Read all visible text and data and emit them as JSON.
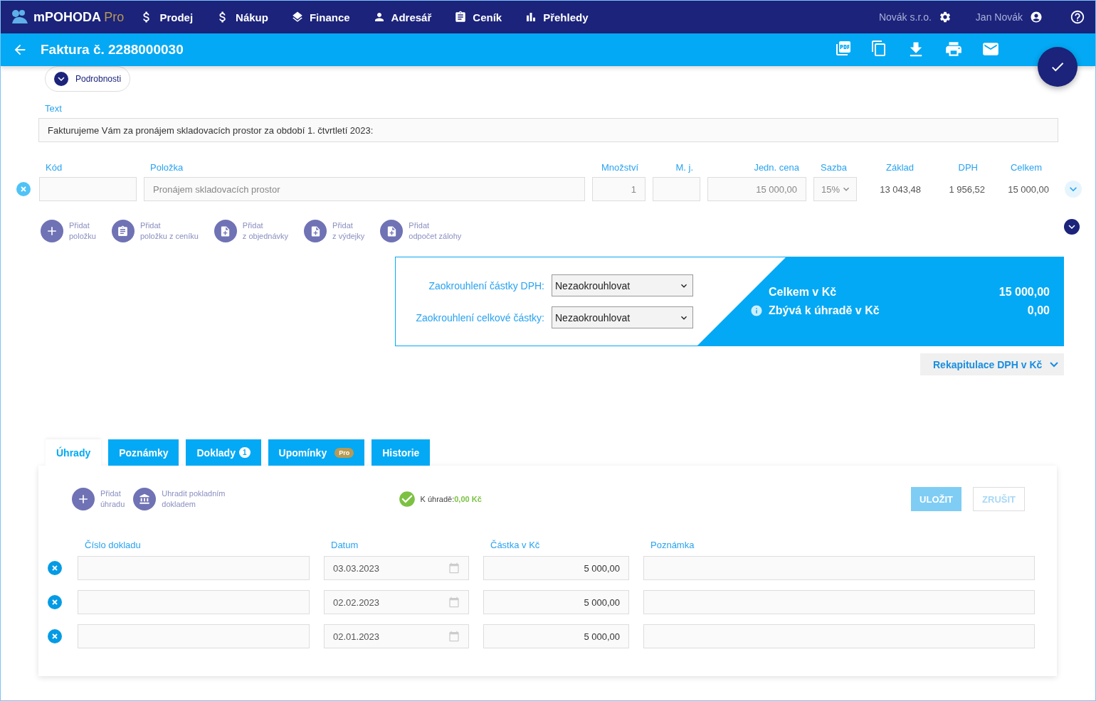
{
  "app": {
    "brand": "mPOHODA",
    "edition": "Pro"
  },
  "nav": [
    {
      "label": "Prodej",
      "kind": "sales"
    },
    {
      "label": "Nákup",
      "kind": "purchase"
    },
    {
      "label": "Finance",
      "kind": "finance"
    },
    {
      "label": "Adresář",
      "kind": "contacts"
    },
    {
      "label": "Ceník",
      "kind": "pricelist"
    },
    {
      "label": "Přehledy",
      "kind": "reports"
    }
  ],
  "company": "Novák s.r.o.",
  "user": "Jan Novák",
  "document": {
    "title": "Faktura č. 2288000030"
  },
  "details_toggle": {
    "label": "Podrobnosti",
    "expanded": false
  },
  "text_field": {
    "label": "Text",
    "value": "Fakturujeme Vám za pronájem skladovacích prostor za období 1. čtvrtletí 2023:"
  },
  "items": {
    "columns": [
      "Kód",
      "Položka",
      "Množství",
      "M. j.",
      "Jedn. cena",
      "Sazba",
      "Základ",
      "DPH",
      "Celkem"
    ],
    "rows": [
      {
        "name": "Pronájem skladovacích prostor",
        "quantity": "1",
        "price": "15 000,00",
        "rate": "15%",
        "base": "13 043,48",
        "vat": "1 956,52",
        "total": "15 000,00"
      }
    ]
  },
  "add_actions": [
    {
      "line1": "Přidat",
      "line2": "položku",
      "kind": "add"
    },
    {
      "line1": "Přidat",
      "line2": "položku z ceníku",
      "kind": "pricelist"
    },
    {
      "line1": "Přidat",
      "line2": "z objednávky",
      "kind": "doc"
    },
    {
      "line1": "Přidat",
      "line2": "z výdejky",
      "kind": "doc"
    },
    {
      "line1": "Přidat",
      "line2": "odpočet zálohy",
      "kind": "doc"
    }
  ],
  "rounding": [
    {
      "label": "Zaokrouhlení částky DPH:",
      "value": "Nezaokrouhlovat"
    },
    {
      "label": "Zaokrouhlení celkové částky:",
      "value": "Nezaokrouhlovat"
    }
  ],
  "totals": [
    {
      "label": "Celkem v Kč",
      "value": "15 000,00",
      "info": false
    },
    {
      "label": "Zbývá k úhradě v Kč",
      "value": "0,00",
      "info": true
    }
  ],
  "recap_button": "Rekapitulace DPH v Kč",
  "tabs": [
    {
      "label": "Úhrady",
      "selected": true
    },
    {
      "label": "Poznámky",
      "selected": false
    },
    {
      "label": "Doklady",
      "selected": false,
      "badge": "1",
      "kind": "count"
    },
    {
      "label": "Upomínky",
      "selected": false,
      "badge": "Pro",
      "kind": "edition"
    },
    {
      "label": "Historie",
      "selected": false
    }
  ],
  "payment_actions": [
    {
      "line1": "Přidat",
      "line2": "úhradu",
      "kind": "add"
    },
    {
      "line1": "Uhradit pokladním",
      "line2": "dokladem",
      "kind": "cash"
    }
  ],
  "payment_status": {
    "label": "K úhradě:",
    "value": "0,00 Kč"
  },
  "buttons": [
    {
      "label": "ULOŽIT",
      "kind": "primary",
      "disabled": true
    },
    {
      "label": "ZRUŠIT",
      "kind": "secondary",
      "disabled": false
    }
  ],
  "payments": {
    "columns": [
      "Číslo dokladu",
      "Datum",
      "Částka v Kč",
      "Poznámka"
    ],
    "rows": [
      {
        "date": "03.03.2023",
        "amount": "5 000,00"
      },
      {
        "date": "02.02.2023",
        "amount": "5 000,00"
      },
      {
        "date": "02.01.2023",
        "amount": "5 000,00"
      }
    ]
  }
}
